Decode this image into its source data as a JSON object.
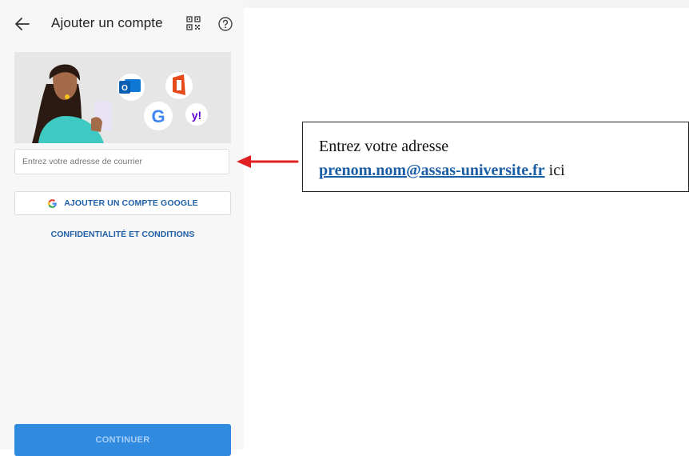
{
  "header": {
    "title": "Ajouter un compte",
    "back_icon": "arrow-left-icon",
    "qr_icon": "qr-code-icon",
    "help_icon": "help-circle-icon"
  },
  "hero": {
    "icons": [
      "woman-illustration",
      "outlook-icon",
      "office-icon",
      "google-icon",
      "yahoo-icon"
    ]
  },
  "email_input": {
    "placeholder": "Entrez votre adresse de courrier",
    "value": ""
  },
  "google_button": {
    "label": "AJOUTER UN COMPTE GOOGLE",
    "icon": "google-g-icon"
  },
  "privacy_link": {
    "label": "CONFIDENTIALITÉ ET CONDITIONS"
  },
  "continue_button": {
    "label": "CONTINUER"
  },
  "annotation": {
    "line1": "Entrez votre adresse",
    "email": "prenom.nom@assas-universite.fr",
    "suffix": "ici"
  },
  "colors": {
    "accent": "#1f5fa8",
    "continue_bg": "#2f8ae0",
    "arrow": "#e02020",
    "link": "#1a5fa6"
  }
}
